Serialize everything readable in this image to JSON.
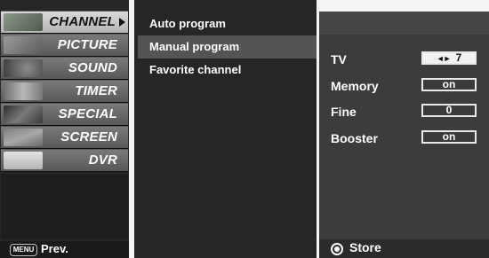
{
  "menu": {
    "categories": [
      {
        "label": "CHANNEL",
        "selected": true,
        "thumb_color": "#6b7a6a"
      },
      {
        "label": "PICTURE",
        "selected": false,
        "thumb_color": "#7d7d7d"
      },
      {
        "label": "SOUND",
        "selected": false,
        "thumb_color": "#6a6a6a"
      },
      {
        "label": "TIMER",
        "selected": false,
        "thumb_color": "#9a9a9a"
      },
      {
        "label": "SPECIAL",
        "selected": false,
        "thumb_color": "#4e4e4e"
      },
      {
        "label": "SCREEN",
        "selected": false,
        "thumb_color": "#8a8a8a"
      },
      {
        "label": "DVR",
        "selected": false,
        "thumb_color": "#c8c8c8"
      }
    ],
    "footer": {
      "key_label": "MENU",
      "prev_label": "Prev."
    }
  },
  "submenu": {
    "items": [
      {
        "label": "Auto program",
        "selected": false
      },
      {
        "label": "Manual program",
        "selected": true
      },
      {
        "label": "Favorite channel",
        "selected": false
      }
    ]
  },
  "settings": {
    "rows": [
      {
        "label": "TV",
        "value": "7",
        "arrows": "◄►"
      },
      {
        "label": "Memory",
        "value": "on"
      },
      {
        "label": "Fine",
        "value": "0"
      },
      {
        "label": "Booster",
        "value": "on"
      }
    ],
    "store_label": "Store",
    "store_icon": "record-circle-icon"
  },
  "colors": {
    "panel_dark": "#262626",
    "panel_right": "#3c3c3c",
    "selected_category": "#d0d0d0",
    "selected_submenu": "#545454"
  }
}
